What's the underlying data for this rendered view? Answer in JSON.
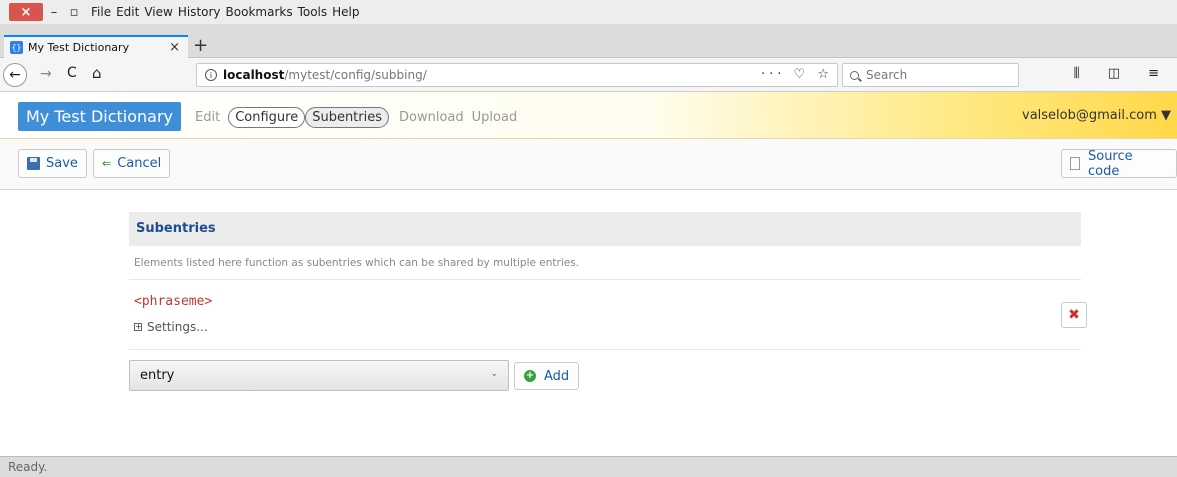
{
  "window": {
    "close_glyph": "×",
    "min_glyph": "–",
    "max_glyph": "▫"
  },
  "menu": [
    "File",
    "Edit",
    "View",
    "History",
    "Bookmarks",
    "Tools",
    "Help"
  ],
  "tab": {
    "favicon": "{}",
    "title": "My Test Dictionary",
    "close_glyph": "×",
    "new_tab_glyph": "+"
  },
  "nav": {
    "back_glyph": "←",
    "forward_glyph": "→",
    "reload_glyph": "C",
    "home_glyph": "⌂",
    "url_host": "localhost",
    "url_path": "/mytest/config/subbing/",
    "url_actions": "··· ♡ ☆",
    "search_placeholder": "Search",
    "right_icons": "⫼ ◫ ≡"
  },
  "app": {
    "title": "My Test Dictionary",
    "nav_edit": "Edit",
    "nav_configure": "Configure",
    "nav_subentries": "Subentries",
    "nav_download": "Download",
    "nav_upload": "Upload",
    "user_email": "valselob@gmail.com ▼"
  },
  "toolbar": {
    "save_label": "Save",
    "cancel_label": "Cancel",
    "source_label": "Source code"
  },
  "panel": {
    "heading": "Subentries",
    "description": "Elements listed here function as subentries which can be shared by multiple entries.",
    "subentry_name": "<phraseme>",
    "settings_label": "Settings...",
    "settings_toggle": "+",
    "delete_glyph": "✖",
    "select_value": "entry",
    "select_caret": "⌄",
    "add_label": "Add",
    "add_glyph": "+"
  },
  "status": {
    "text": "Ready."
  },
  "colors": {
    "accent": "#3f8fd8",
    "link": "#1a5aa6",
    "element_name": "#c0392b",
    "delete": "#d0312d",
    "window_close": "#d9534f"
  }
}
